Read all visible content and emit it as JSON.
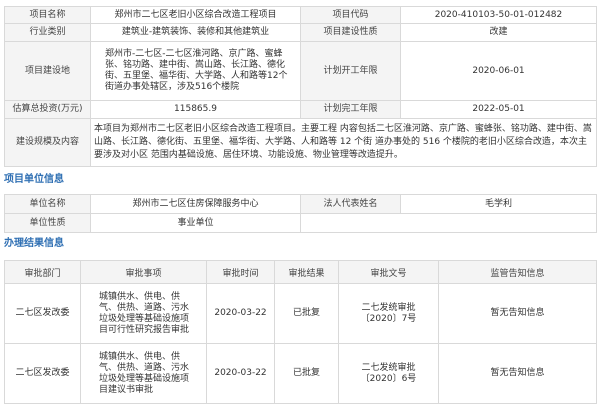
{
  "project": {
    "name_label": "项目名称",
    "name": "郑州市二七区老旧小区综合改造工程项目",
    "code_label": "项目代码",
    "code": "2020-410103-50-01-012482",
    "industry_label": "行业类别",
    "industry": "建筑业-建筑装饰、装修和其他建筑业",
    "nature_label": "项目建设性质",
    "nature": "改建",
    "location_label": "项目建设地",
    "location": "郑州市-二七区-二七区淮河路、京广路、蜜蜂张、铭功路、建中街、嵩山路、长江路、德化街、五里堡、福华街、大学路、人和路等12个街道办事处辖区，涉及516个楼院",
    "start_label": "计划开工年限",
    "start": "2020-06-01",
    "investment_label": "估算总投资(万元)",
    "investment": "115865.9",
    "end_label": "计划完工年限",
    "end": "2022-05-01",
    "scale_label": "建设规模及内容",
    "scale": "本项目为郑州市二七区老旧小区综合改造工程项目。主要工程 内容包括二七区淮河路、京广路、蜜蜂张、铭功路、建中街、嵩山路、长江路、德化街、五里堡、福华街、大学路、人和路等 12 个街 道办事处的 516 个楼院的老旧小区综合改造，本次主要涉及对小区 范围内基础设施、居住环境、功能设施、物业管理等改造提升。"
  },
  "unit_section": {
    "title": "项目单位信息",
    "unit_name_label": "单位名称",
    "unit_name": "郑州市二七区住房保障服务中心",
    "legal_label": "法人代表姓名",
    "legal": "毛学利",
    "unit_nature_label": "单位性质",
    "unit_nature": "事业单位"
  },
  "result_section": {
    "title": "办理结果信息",
    "headers": [
      "审批部门",
      "审批事项",
      "审批时间",
      "审批结果",
      "审批文号",
      "监管告知信息"
    ],
    "rows": [
      {
        "dept": "二七区发改委",
        "item": "城镇供水、供电、供气、供热、道路、污水垃圾处理等基础设施项目可行性研究报告审批",
        "time": "2020-03-22",
        "result": "已批复",
        "doc": "二七发统审批〔2020〕7号",
        "notice": "暂无告知信息"
      },
      {
        "dept": "二七区发改委",
        "item": "城镇供水、供电、供气、供热、道路、污水垃圾处理等基础设施项目建议书审批",
        "time": "2020-03-22",
        "result": "已批复",
        "doc": "二七发统审批〔2020〕6号",
        "notice": "暂无告知信息"
      }
    ]
  }
}
